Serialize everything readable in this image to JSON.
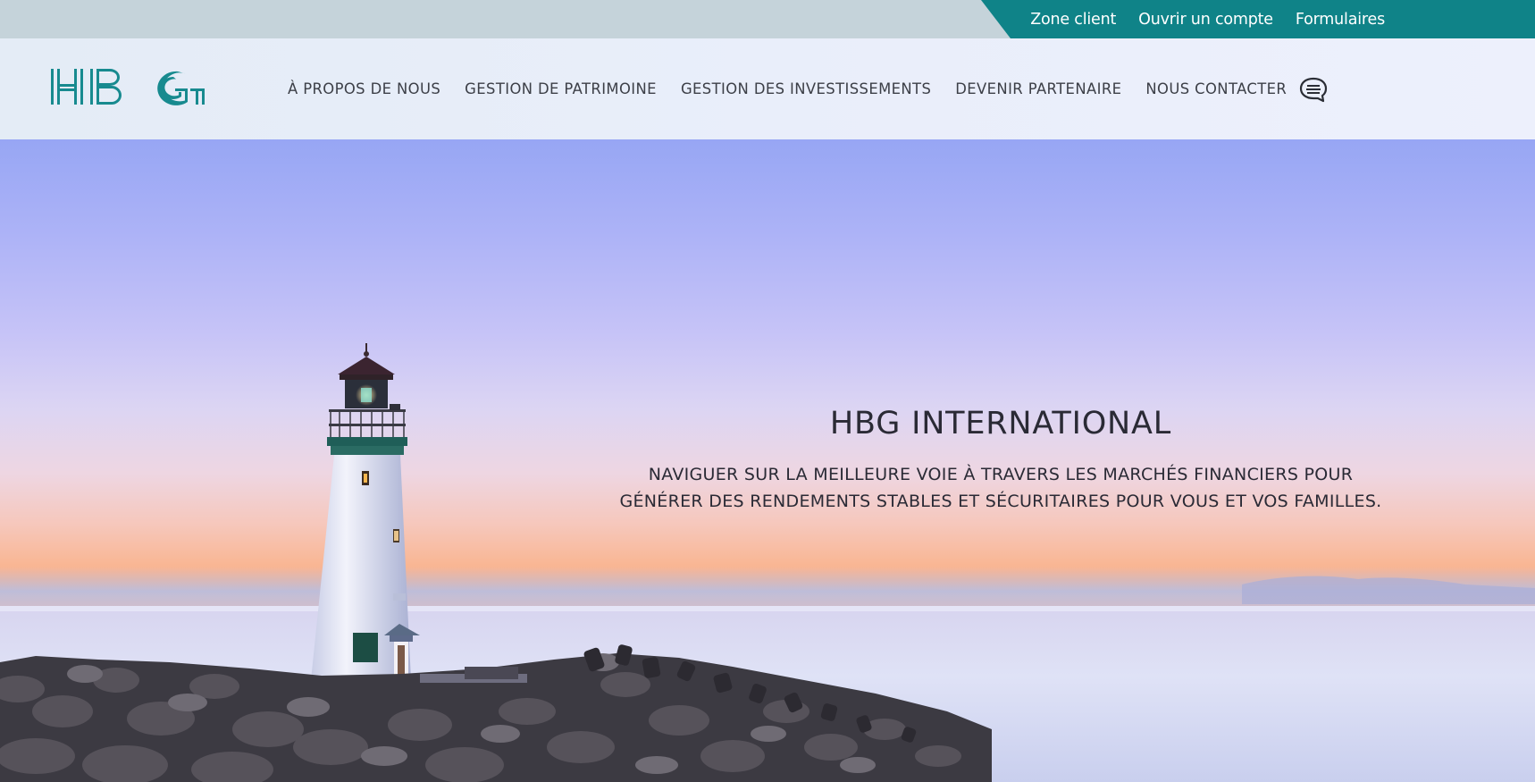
{
  "topbar": {
    "links": [
      "Zone client",
      "Ouvrir un compte",
      "Formulaires"
    ],
    "accent_color": "#0f8388"
  },
  "header": {
    "logo_text": "HBG",
    "nav": [
      "À PROPOS DE NOUS",
      "GESTION DE PATRIMOINE",
      "GESTION DES INVESTISSEMENTS",
      "DEVENIR PARTENAIRE",
      "NOUS CONTACTER"
    ],
    "chat_icon": "chat-bubble-icon"
  },
  "hero": {
    "title": "HBG INTERNATIONAL",
    "subtitle": "NAVIGUER SUR LA MEILLEURE VOIE À TRAVERS LES MARCHÉS FINANCIERS POUR GÉNÉRER DES RENDEMENTS STABLES ET SÉCURITAIRES POUR VOUS ET VOS FAMILLES.",
    "background_image": "lighthouse-sunset-photo"
  }
}
